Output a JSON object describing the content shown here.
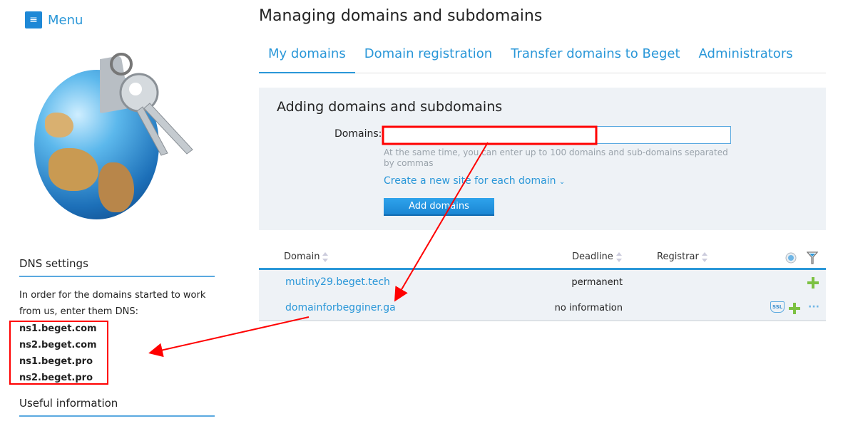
{
  "sidebar": {
    "menu_label": "Menu",
    "menu_icon": "hamburger-icon",
    "dns_heading": "DNS settings",
    "dns_text": "In order for the domains started to work from us, enter them DNS:",
    "ns": [
      "ns1.beget.com",
      "ns2.beget.com",
      "ns1.beget.pro",
      "ns2.beget.pro"
    ],
    "useful_heading": "Useful information"
  },
  "header": {
    "title": "Managing domains and subdomains"
  },
  "tabs": [
    {
      "label": "My domains",
      "active": true
    },
    {
      "label": "Domain registration"
    },
    {
      "label": "Transfer domains to Beget"
    },
    {
      "label": "Administrators"
    }
  ],
  "add_panel": {
    "title": "Adding domains and subdomains",
    "domains_label": "Domains:",
    "domains_value": "",
    "hint": "At the same time, you can enter up to 100 domains and sub-domains separated by commas",
    "create_site_link": "Create a new site for each domain",
    "add_button": "Add domains"
  },
  "table": {
    "columns": {
      "domain": "Domain",
      "deadline": "Deadline",
      "registrar": "Registrar"
    },
    "rows": [
      {
        "domain": "mutiny29.beget.tech",
        "deadline": "permanent",
        "registrar": ""
      },
      {
        "domain": "domainforbegginer.ga",
        "deadline": "no information",
        "registrar": "",
        "ssl": "SSL"
      }
    ]
  },
  "colors": {
    "accent": "#2a97d8",
    "annotation": "#ff0000",
    "plus": "#7cc142"
  }
}
